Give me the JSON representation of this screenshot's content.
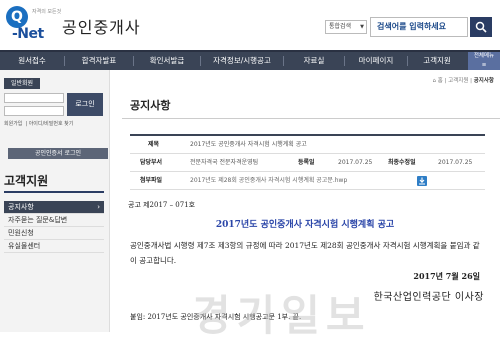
{
  "header": {
    "logo_mark": "Q",
    "logo_net": "-Net",
    "logo_slogan": "자격의 모든것",
    "site_title": "공인중개사",
    "search_select": "통합검색",
    "search_placeholder": "검색어를 입력하세요"
  },
  "gnb": {
    "items": [
      "원서접수",
      "합격자발표",
      "확인서발급",
      "자격정보/시행공고",
      "자료실",
      "마이페이지",
      "고객지원"
    ],
    "all_menu": "전체메뉴"
  },
  "login": {
    "tab": "일반회원",
    "button": "로그인",
    "links": [
      "회원가입",
      "아이디/비밀번호 찾기"
    ],
    "cert_button": "공인인증서 로그인"
  },
  "lnb": {
    "title": "고객지원",
    "items": [
      {
        "label": "공지사항",
        "active": true
      },
      {
        "label": "자주묻는 질문&답변",
        "active": false
      },
      {
        "label": "민원신청",
        "active": false
      },
      {
        "label": "유실물센터",
        "active": false
      }
    ]
  },
  "content": {
    "breadcrumb": [
      "홈",
      "고객지원",
      "공지사항"
    ],
    "page_title": "공지사항",
    "table": {
      "subject_label": "제목",
      "subject": "2017년도 공인중개사 자격시험 시행계획 공고",
      "dept_label": "담당부서",
      "dept": "전문자격국 전문자격운영팀",
      "reg_label": "등록일",
      "reg_date": "2017.07.25",
      "mod_label": "최종수정일",
      "mod_date": "2017.07.25",
      "file_label": "첨부파일",
      "file_name": "2017년도 제28회 공인중개사 자격시험 시행계획 공고문.hwp"
    },
    "notice_no": "공고 제2017 – 071호",
    "notice_headline": "2017년도 공인중개사 자격시험 시행계획 공고",
    "notice_body": "공인중개사법 시행령 제7조 제3항의 규정에 따라 2017년도 제28회 공인중개사 자격시험 시행계획을 붙임과 같이 공고합니다.",
    "notice_date": "2017년 7월 26일",
    "notice_org": "한국산업인력공단 이사장",
    "notice_attach": "붙임: 2017년도 공인중개사 자격시험 시행공고문 1부. 끝."
  },
  "watermark": "경기일보",
  "colors": {
    "nav_bg": "#3a4456",
    "brand_blue": "#1b6fc0",
    "headline_blue": "#2a45a8"
  }
}
